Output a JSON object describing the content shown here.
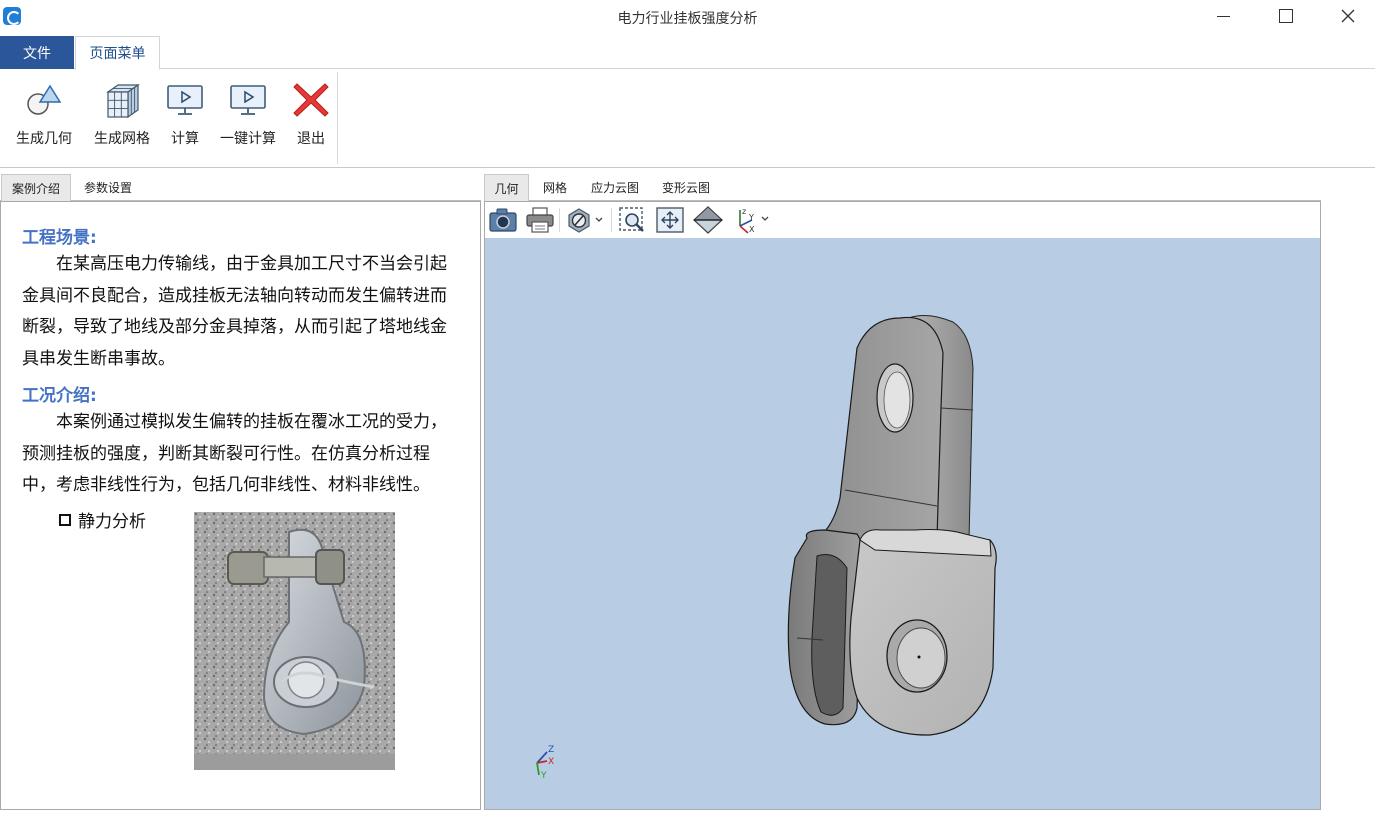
{
  "window": {
    "title": "电力行业挂板强度分析",
    "min_symbol": "—",
    "max_symbol": "□",
    "close_symbol": "✕"
  },
  "ribbon": {
    "tabs": [
      {
        "label": "文件",
        "active": false
      },
      {
        "label": "页面菜单",
        "active": true
      }
    ],
    "buttons": [
      {
        "label": "生成几何",
        "icon": "geometry-shapes-icon"
      },
      {
        "label": "生成网格",
        "icon": "mesh-cube-icon"
      },
      {
        "label": "计算",
        "icon": "monitor-play-icon"
      },
      {
        "label": "一键计算",
        "icon": "monitor-play-icon"
      },
      {
        "label": "退出",
        "icon": "red-x-icon"
      }
    ]
  },
  "left_panel": {
    "tabs": [
      {
        "label": "案例介绍",
        "active": true
      },
      {
        "label": "参数设置",
        "active": false
      }
    ],
    "section1": {
      "heading": "工程场景:",
      "text": "在某高压电力传输线，由于金具加工尺寸不当会引起金具间不良配合，造成挂板无法轴向转动而发生偏转进而断裂，导致了地线及部分金具掉落，从而引起了塔地线金具串发生断串事故。"
    },
    "section2": {
      "heading": "工况介绍:",
      "text": "本案例通过模拟发生偏转的挂板在覆冰工况的受力，预测挂板的强度，判断其断裂可行性。在仿真分析过程中，考虑非线性行为，包括几何非线性、材料非线性。"
    },
    "bullet": "静力分析"
  },
  "right_panel": {
    "tabs": [
      {
        "label": "几何",
        "active": true
      },
      {
        "label": "网格",
        "active": false
      },
      {
        "label": "应力云图",
        "active": false
      },
      {
        "label": "变形云图",
        "active": false
      }
    ],
    "toolbar": [
      {
        "icon": "camera-icon"
      },
      {
        "icon": "printer-icon"
      },
      {
        "icon": "display-mode-icon"
      },
      {
        "icon": "zoom-window-icon"
      },
      {
        "icon": "fit-all-icon"
      },
      {
        "icon": "iso-view-icon"
      },
      {
        "icon": "axis-view-icon"
      }
    ],
    "triad_labels": {
      "z": "Z",
      "x": "X",
      "y": "Y"
    },
    "colors": {
      "viewport_bg": "#b8cde4",
      "model_gray": "#9a9a9a"
    }
  },
  "colors": {
    "accent": "#2b579a",
    "heading_blue": "#4472c4",
    "exit_red": "#e03a3a"
  }
}
